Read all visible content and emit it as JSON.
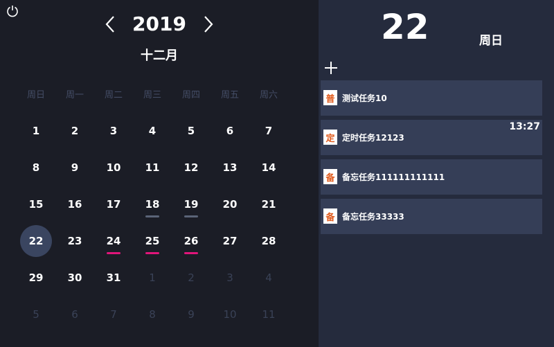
{
  "calendar": {
    "year": "2019",
    "month": "十二月",
    "weekdays": [
      "周日",
      "周一",
      "周二",
      "周三",
      "周四",
      "周五",
      "周六"
    ],
    "days": [
      {
        "d": "1"
      },
      {
        "d": "2"
      },
      {
        "d": "3"
      },
      {
        "d": "4"
      },
      {
        "d": "5"
      },
      {
        "d": "6"
      },
      {
        "d": "7"
      },
      {
        "d": "8"
      },
      {
        "d": "9"
      },
      {
        "d": "10"
      },
      {
        "d": "11"
      },
      {
        "d": "12"
      },
      {
        "d": "13"
      },
      {
        "d": "14"
      },
      {
        "d": "15"
      },
      {
        "d": "16"
      },
      {
        "d": "17"
      },
      {
        "d": "18",
        "mark": "grey"
      },
      {
        "d": "19",
        "mark": "grey"
      },
      {
        "d": "20"
      },
      {
        "d": "21"
      },
      {
        "d": "22",
        "selected": true
      },
      {
        "d": "23"
      },
      {
        "d": "24",
        "mark": "pink"
      },
      {
        "d": "25",
        "mark": "pink"
      },
      {
        "d": "26",
        "mark": "pink"
      },
      {
        "d": "27"
      },
      {
        "d": "28"
      },
      {
        "d": "29"
      },
      {
        "d": "30"
      },
      {
        "d": "31"
      },
      {
        "d": "1",
        "other": true
      },
      {
        "d": "2",
        "other": true
      },
      {
        "d": "3",
        "other": true
      },
      {
        "d": "4",
        "other": true
      },
      {
        "d": "5",
        "other": true
      },
      {
        "d": "6",
        "other": true
      },
      {
        "d": "7",
        "other": true
      },
      {
        "d": "8",
        "other": true
      },
      {
        "d": "9",
        "other": true
      },
      {
        "d": "10",
        "other": true
      },
      {
        "d": "11",
        "other": true
      }
    ]
  },
  "detail": {
    "day": "22",
    "weekday": "周日"
  },
  "tasks": [
    {
      "badge": "普",
      "title": "测试任务10",
      "time": ""
    },
    {
      "badge": "定",
      "title": "定时任务12123",
      "time": "13:27"
    },
    {
      "badge": "备",
      "title": "备忘任务111111111111",
      "time": ""
    },
    {
      "badge": "备",
      "title": "备忘任务33333",
      "time": ""
    }
  ],
  "icons": {
    "power": "power-icon",
    "prev": "chevron-left-icon",
    "next": "chevron-right-icon",
    "add": "plus-icon"
  },
  "colors": {
    "accent_pink": "#e0157a",
    "badge_text": "#e05a1c"
  }
}
